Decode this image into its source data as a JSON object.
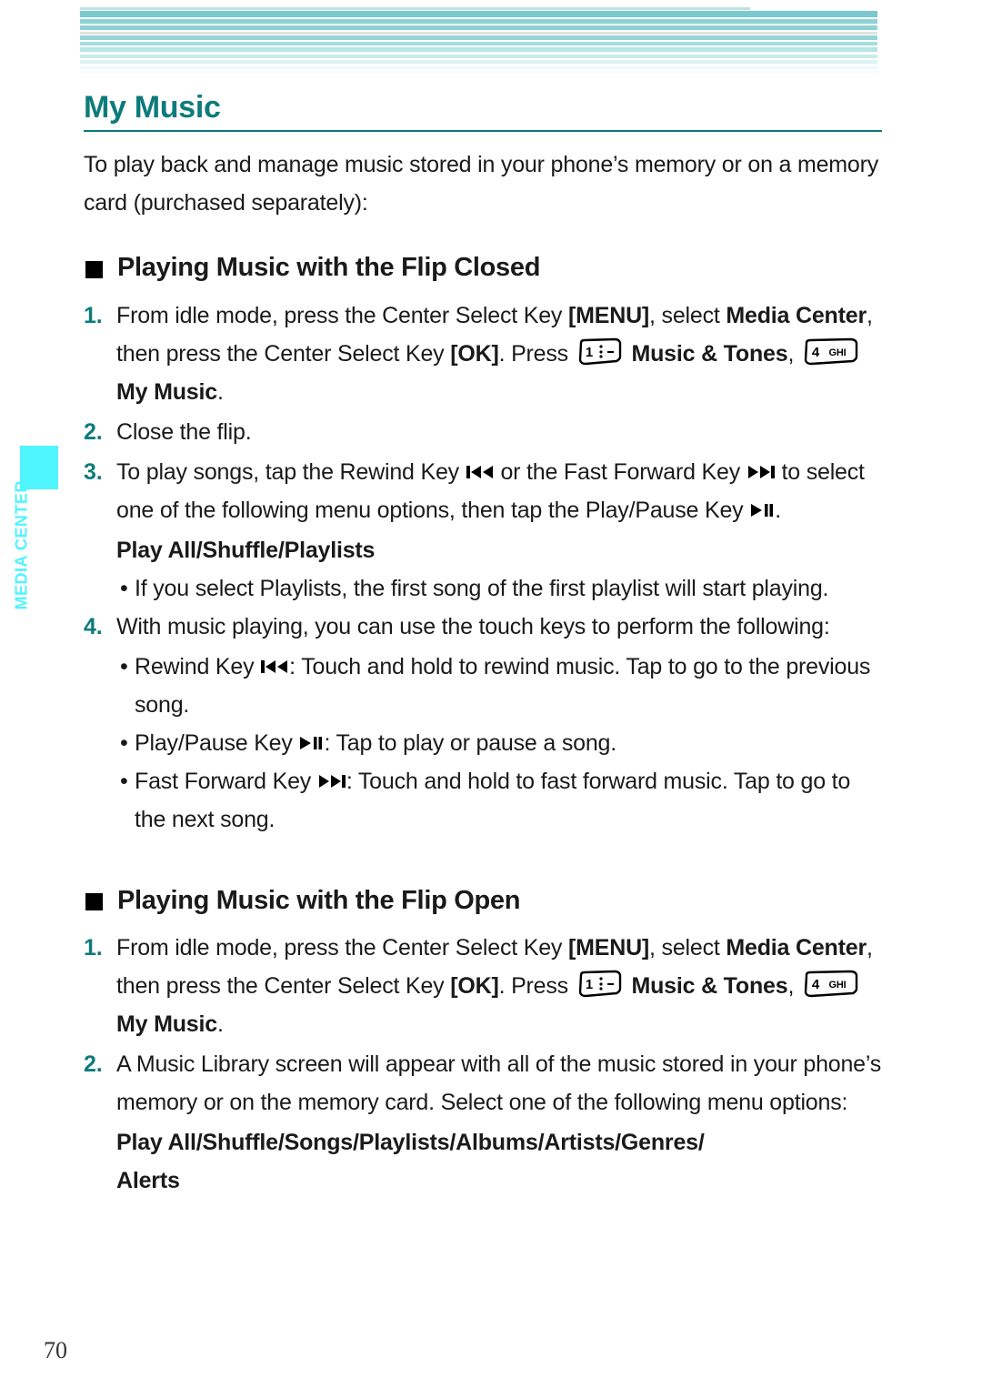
{
  "colors": {
    "heading_teal": "#0d7b7b",
    "stripe_teal": "#7fcfd4",
    "tab_cyan": "#4ff5ff",
    "text_black": "#1a1a1a"
  },
  "side_tab": {
    "label": "MEDIA CENTER"
  },
  "page": {
    "number": "70"
  },
  "title": "My Music",
  "intro": "To play back and manage music stored in your phone’s memory or on a memory card (purchased separately):",
  "sections": [
    {
      "heading": "Playing Music with the Flip Closed",
      "steps": [
        {
          "num": "1.",
          "part1": "From idle mode, press the Center Select Key ",
          "menu_key": "[MENU]",
          "part2": ", select ",
          "media_center": "Media Center",
          "part3": ", then press the Center Select Key ",
          "ok_key": "[OK]",
          "part4": ". Press ",
          "key1_label": "1",
          "part5": " ",
          "music_tones": "Music & Tones",
          "part6": ", ",
          "key4_digit": "4",
          "key4_letters": "GHI",
          "part7": " ",
          "my_music": "My Music",
          "part8": "."
        },
        {
          "num": "2.",
          "text": "Close the flip."
        },
        {
          "num": "3.",
          "part1": "To play songs, tap the Rewind Key ",
          "icon1": "rewind-icon",
          "part2": " or the Fast Forward Key ",
          "icon2": "fast-forward-icon",
          "part3": " to select one of the following menu options, then tap the Play/Pause Key ",
          "icon3": "play-pause-icon",
          "part4": "."
        }
      ],
      "menu_options_line": "Play All/Shuffle/Playlists",
      "note_bullet": "If you select Playlists, the first song of the first playlist will start playing.",
      "step4": {
        "num": "4.",
        "text": "With music playing, you can use the touch keys to perform the following:"
      },
      "touch_keys": [
        {
          "label": "Rewind Key ",
          "icon": "rewind-icon",
          "desc": ": Touch and hold to rewind music. Tap to go to the previous song."
        },
        {
          "label": "Play/Pause Key ",
          "icon": "play-pause-icon",
          "desc": ": Tap to play or pause a song."
        },
        {
          "label": "Fast Forward Key ",
          "icon": "fast-forward-icon",
          "desc": ": Touch and hold to fast forward music. Tap to go to the next song."
        }
      ]
    },
    {
      "heading": "Playing Music with the Flip Open",
      "steps": [
        {
          "num": "1.",
          "part1": "From idle mode, press the Center Select Key ",
          "menu_key": "[MENU]",
          "part2": ", select ",
          "media_center": "Media Center",
          "part3": ", then press the Center Select Key ",
          "ok_key": "[OK]",
          "part4": ". Press ",
          "key1_label": "1",
          "part5": " ",
          "music_tones": "Music & Tones",
          "part6": ", ",
          "key4_digit": "4",
          "key4_letters": "GHI",
          "part7": " ",
          "my_music": "My Music",
          "part8": "."
        },
        {
          "num": "2.",
          "text": "A Music Library screen will appear with all of the music stored in your phone’s memory or on the memory card. Select one of the following menu options:"
        }
      ],
      "menu_options_line1": "Play All/Shuffle/Songs/Playlists/Albums/Artists/Genres/",
      "menu_options_line2": "Alerts"
    }
  ]
}
